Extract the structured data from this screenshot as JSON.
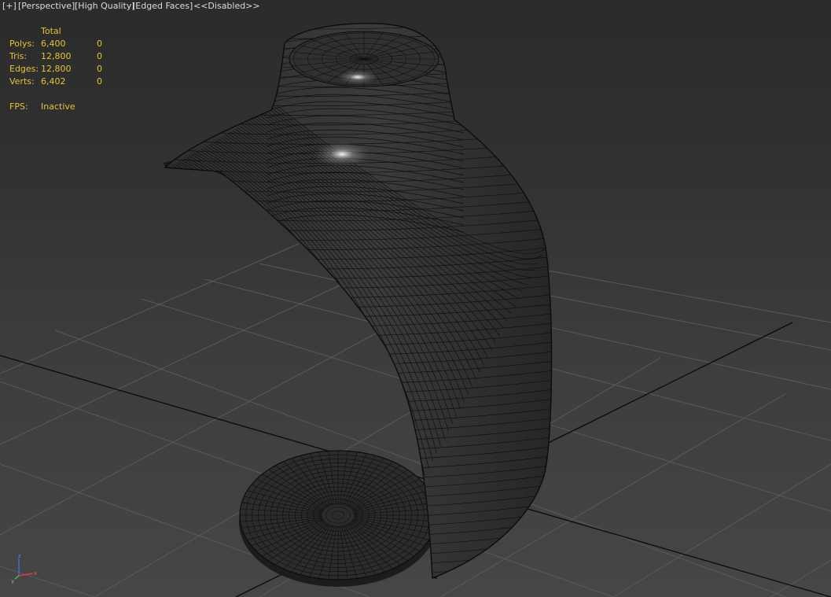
{
  "viewport_menu": {
    "plus": "[+]",
    "view": "[Perspective]",
    "quality": "[High Quality]",
    "shading": "[Edged Faces]",
    "status": "<<Disabled>>"
  },
  "stats": {
    "header": "Total",
    "rows": [
      {
        "label": "Polys:",
        "total": "6,400",
        "selected": "0"
      },
      {
        "label": "Tris:",
        "total": "12,800",
        "selected": "0"
      },
      {
        "label": "Edges:",
        "total": "12,800",
        "selected": "0"
      },
      {
        "label": "Verts:",
        "total": "6,402",
        "selected": "0"
      }
    ],
    "fps_label": "FPS:",
    "fps_value": "Inactive"
  },
  "axis_gizmo": {
    "x": "x",
    "y": "y",
    "z": "z"
  },
  "colors": {
    "stats_text": "#e6c23c",
    "grid": "#5a5a5a",
    "grid_axis": "#0a0a0a",
    "mesh": "#2a2a2a",
    "wire": "#0e0e0e"
  }
}
